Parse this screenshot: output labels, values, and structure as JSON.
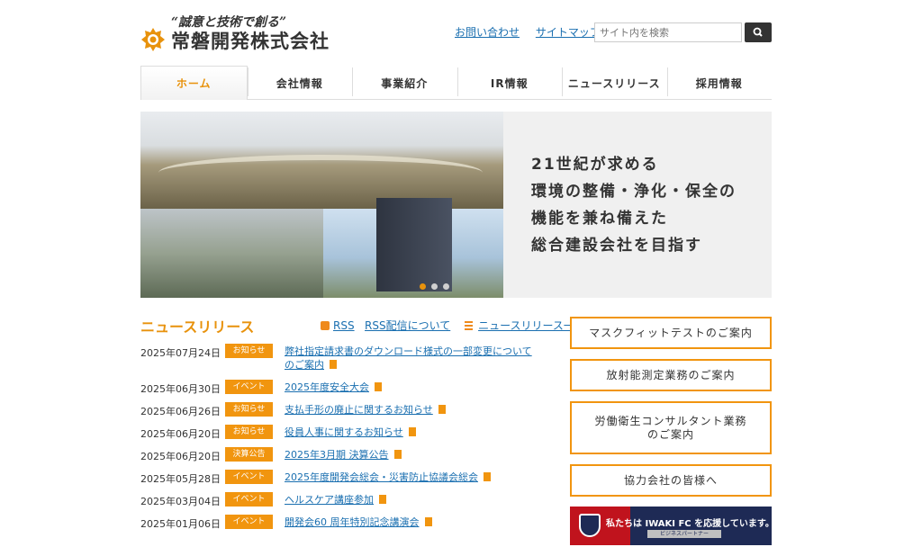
{
  "header": {
    "slogan": "“誠意と技術で創る”",
    "company_name": "常磐開発株式会社",
    "links": [
      "お問い合わせ",
      "サイトマップ"
    ],
    "search_placeholder": "サイト内を検索",
    "accent_color": "#e8920c"
  },
  "nav": {
    "items": [
      "ホーム",
      "会社情報",
      "事業紹介",
      "IR情報",
      "ニュースリリース",
      "採用情報"
    ],
    "active_index": 0
  },
  "hero": {
    "lines": [
      "21世紀が求める",
      "環境の整備・浄化・保全の",
      "機能を兼ね備えた",
      "総合建設会社を目指す"
    ],
    "slide_count": 3,
    "active_slide": 0
  },
  "news": {
    "title": "ニュースリリース",
    "rss_label": "RSS",
    "rss_about_label": "RSS配信について",
    "list_label": "ニュースリリース一覧",
    "items": [
      {
        "date": "2025年07月24日",
        "badge": "お知らせ",
        "title": "弊社指定請求書のダウンロード様式の一部変更についてのご案内"
      },
      {
        "date": "2025年06月30日",
        "badge": "イベント",
        "title": "2025年度安全大会"
      },
      {
        "date": "2025年06月26日",
        "badge": "お知らせ",
        "title": "支払手形の廃止に関するお知らせ"
      },
      {
        "date": "2025年06月20日",
        "badge": "お知らせ",
        "title": "役員人事に関するお知らせ"
      },
      {
        "date": "2025年06月20日",
        "badge": "決算公告",
        "title": "2025年3月期 決算公告"
      },
      {
        "date": "2025年05月28日",
        "badge": "イベント",
        "title": "2025年度開発会総会・災害防止協議会総会"
      },
      {
        "date": "2025年03月04日",
        "badge": "イベント",
        "title": "ヘルスケア講座参加"
      },
      {
        "date": "2025年01月06日",
        "badge": "イベント",
        "title": "開発会60 周年特別記念講演会"
      }
    ]
  },
  "sidebar": {
    "buttons": [
      "マスクフィットテストのご案内",
      "放射能測定業務のご案内",
      "労働衛生コンサルタント業務のご案内",
      "協力会社の皆様へ"
    ],
    "sponsor_text": "私たちは IWAKI FC を応援しています。",
    "sponsor_sub": "ビジネスパートナー"
  }
}
